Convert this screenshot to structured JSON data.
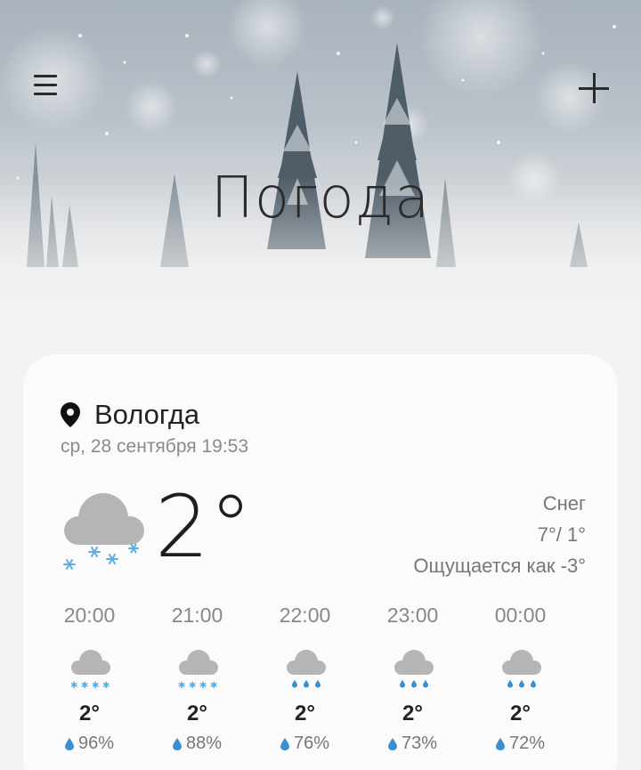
{
  "header": {
    "title": "Погода",
    "menu_icon": "hamburger-menu-icon",
    "add_icon": "plus-icon"
  },
  "location": {
    "city": "Вологда",
    "datetime": "ср, 28 сентября 19:53",
    "pin_icon": "location-pin-icon"
  },
  "current": {
    "temperature": "2°",
    "condition": "Снег",
    "high_low": "7°/ 1°",
    "feels_like": "Ощущается как -3°",
    "icon": "snow-cloud-icon"
  },
  "hourly": [
    {
      "time": "20:00",
      "temp": "2°",
      "precip": "96%",
      "icon": "snow-icon"
    },
    {
      "time": "21:00",
      "temp": "2°",
      "precip": "88%",
      "icon": "snow-icon"
    },
    {
      "time": "22:00",
      "temp": "2°",
      "precip": "76%",
      "icon": "rain-icon"
    },
    {
      "time": "23:00",
      "temp": "2°",
      "precip": "73%",
      "icon": "rain-icon"
    },
    {
      "time": "00:00",
      "temp": "2°",
      "precip": "72%",
      "icon": "rain-icon"
    }
  ],
  "colors": {
    "snowflake": "#5aaee0",
    "raindrop": "#3a8fd0",
    "cloud": "#b8b8b8"
  }
}
